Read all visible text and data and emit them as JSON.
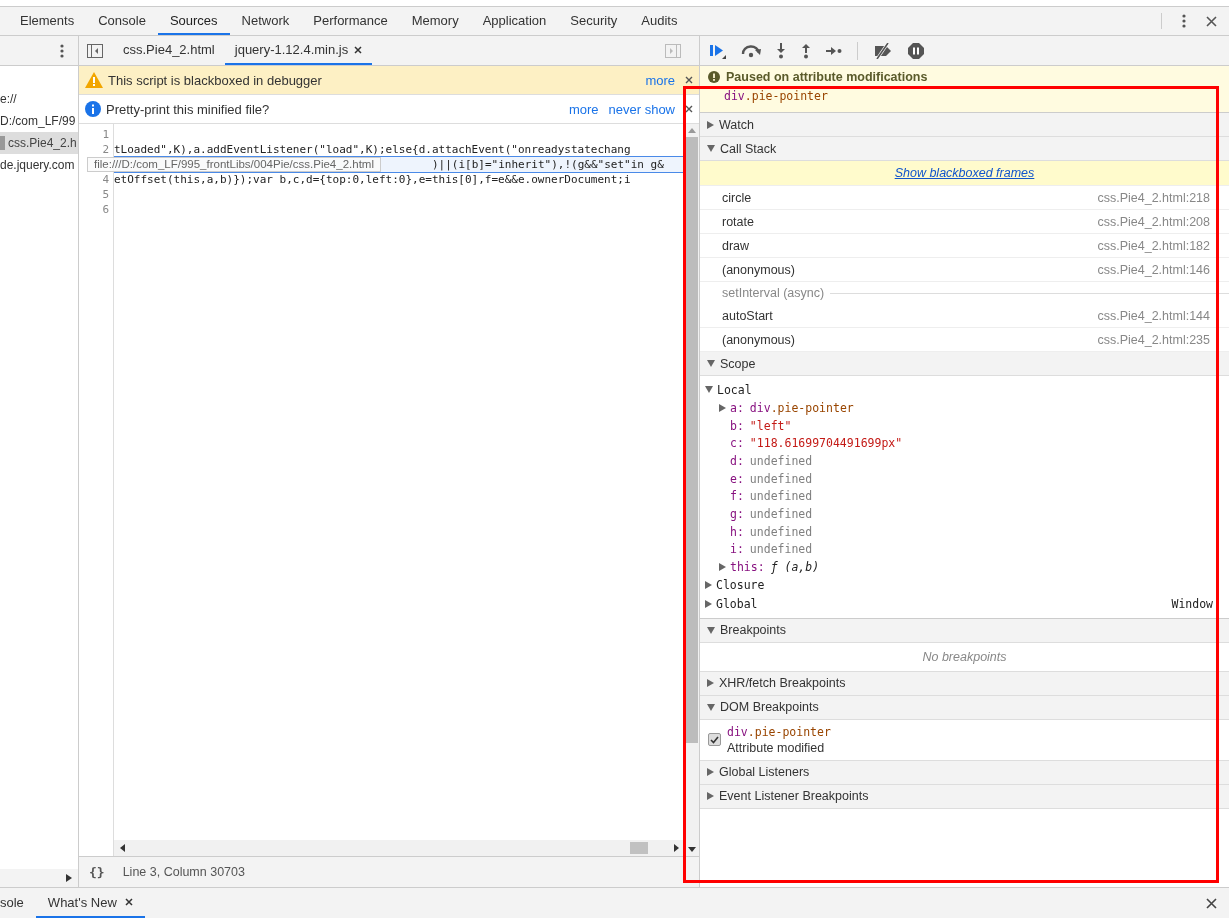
{
  "main_tabs": [
    {
      "label": "Elements",
      "selected": false
    },
    {
      "label": "Console",
      "selected": false
    },
    {
      "label": "Sources",
      "selected": true
    },
    {
      "label": "Network",
      "selected": false
    },
    {
      "label": "Performance",
      "selected": false
    },
    {
      "label": "Memory",
      "selected": false
    },
    {
      "label": "Application",
      "selected": false
    },
    {
      "label": "Security",
      "selected": false
    },
    {
      "label": "Audits",
      "selected": false
    }
  ],
  "navigator": {
    "items": [
      {
        "label": "e://",
        "kind": "folder",
        "selected": false
      },
      {
        "label": "D:/com_LF/99",
        "kind": "folder",
        "selected": false
      },
      {
        "label": "css.Pie4_2.h",
        "kind": "file",
        "selected": true
      },
      {
        "label": "de.jquery.com",
        "kind": "folder",
        "selected": false
      }
    ]
  },
  "editor": {
    "tabs": [
      {
        "label": "css.Pie4_2.html",
        "selected": false,
        "closable": false
      },
      {
        "label": "jquery-1.12.4.min.js",
        "selected": true,
        "closable": true
      }
    ],
    "infobars": [
      {
        "kind": "warning",
        "message": "This script is blackboxed in debugger",
        "links": [
          "more"
        ]
      },
      {
        "kind": "info",
        "message": "Pretty-print this minified file?",
        "links": [
          "more",
          "never show"
        ]
      }
    ],
    "lines": [
      {
        "number": "1",
        "selected": false
      },
      {
        "number": "2",
        "selected": false,
        "code": "tLoaded\",K),a.addEventListener(\"load\",K);else{d.attachEvent(\"onreadystatechang"
      },
      {
        "selected": true,
        "code": ")||(i[b]=\"inherit\"),!(g&&\"set\"in g&"
      },
      {
        "number": "4",
        "selected": false,
        "code": "etOffset(this,a,b)});var b,c,d={top:0,left:0},e=this[0],f=e&&e.ownerDocument;i"
      },
      {
        "number": "5",
        "selected": false
      },
      {
        "number": "6",
        "selected": false
      }
    ],
    "tooltip": "file:///D:/com_LF/995_frontLibs/004Pie/css.Pie4_2.html",
    "format_button": "{}",
    "status": "Line 3, Column 30703"
  },
  "debugger": {
    "paused": {
      "title": "Paused on attribute modifications",
      "tag": "div",
      "selector": ".pie-pointer"
    },
    "sections": [
      {
        "kind": "watch",
        "title": "Watch",
        "expanded": false
      },
      {
        "kind": "call_stack",
        "title": "Call Stack",
        "expanded": true,
        "link": "Show blackboxed frames",
        "frames": [
          {
            "kind": "frame",
            "name": "circle",
            "location": "css.Pie4_2.html:218"
          },
          {
            "kind": "frame",
            "name": "rotate",
            "location": "css.Pie4_2.html:208"
          },
          {
            "kind": "frame",
            "name": "draw",
            "location": "css.Pie4_2.html:182"
          },
          {
            "kind": "frame",
            "name": "(anonymous)",
            "location": "css.Pie4_2.html:146"
          },
          {
            "kind": "async",
            "name": "setInterval (async)"
          },
          {
            "kind": "frame",
            "name": "autoStart",
            "location": "css.Pie4_2.html:144"
          },
          {
            "kind": "frame",
            "name": "(anonymous)",
            "location": "css.Pie4_2.html:235"
          }
        ]
      },
      {
        "kind": "scope",
        "title": "Scope",
        "expanded": true,
        "scopes": [
          {
            "label": "Local",
            "expanded": true,
            "children": [
              {
                "name": "a:",
                "kind": "node",
                "expandable": true,
                "tag": "div",
                "selector": ".pie-pointer"
              },
              {
                "name": "b:",
                "kind": "string",
                "expandable": false,
                "value": "\"left\""
              },
              {
                "name": "c:",
                "kind": "string",
                "expandable": false,
                "value": "\"118.61699704491699px\""
              },
              {
                "name": "d:",
                "kind": "undefined",
                "expandable": false,
                "value": "undefined"
              },
              {
                "name": "e:",
                "kind": "undefined",
                "expandable": false,
                "value": "undefined"
              },
              {
                "name": "f:",
                "kind": "undefined",
                "expandable": false,
                "value": "undefined"
              },
              {
                "name": "g:",
                "kind": "undefined",
                "expandable": false,
                "value": "undefined"
              },
              {
                "name": "h:",
                "kind": "undefined",
                "expandable": false,
                "value": "undefined"
              },
              {
                "name": "i:",
                "kind": "undefined",
                "expandable": false,
                "value": "undefined"
              },
              {
                "name": "this:",
                "kind": "function",
                "expandable": true,
                "value": "ƒ (a,b)"
              }
            ]
          },
          {
            "label": "Closure",
            "expanded": false
          },
          {
            "label": "Global",
            "expanded": false,
            "value": "Window"
          }
        ]
      },
      {
        "kind": "breakpoints",
        "title": "Breakpoints",
        "expanded": true,
        "empty": "No breakpoints"
      },
      {
        "kind": "watch",
        "title": "XHR/fetch Breakpoints",
        "expanded": false
      },
      {
        "kind": "dom_breakpoints",
        "title": "DOM Breakpoints",
        "expanded": true,
        "entries": [
          {
            "tag": "div",
            "selector": ".pie-pointer",
            "type": "Attribute modified",
            "checked": true
          }
        ]
      },
      {
        "kind": "watch",
        "title": "Global Listeners",
        "expanded": false
      },
      {
        "kind": "watch",
        "title": "Event Listener Breakpoints",
        "expanded": false
      }
    ]
  },
  "drawer": {
    "tabs": [
      {
        "label": "sole",
        "selected": false,
        "closable": false
      },
      {
        "label": "What's New",
        "selected": true,
        "closable": true
      }
    ]
  }
}
